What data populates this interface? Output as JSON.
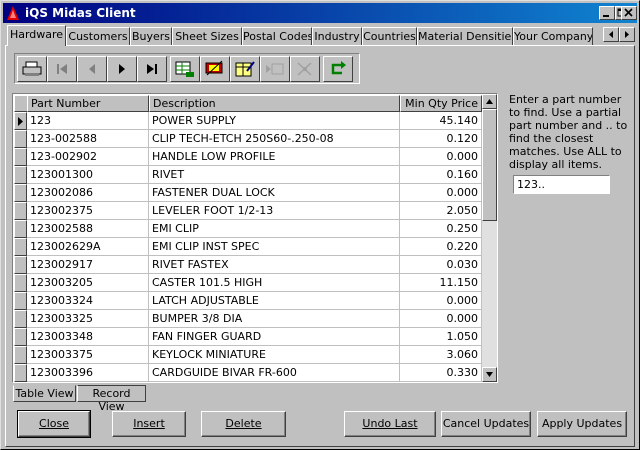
{
  "window": {
    "title": "iQS Midas Client"
  },
  "tabs": [
    "Hardware",
    "Customers",
    "Buyers",
    "Sheet Sizes",
    "Postal Codes",
    "Industry",
    "Countries",
    "Material Densities",
    "Your Company"
  ],
  "toolbar": {
    "icons": [
      "print-icon",
      "first-record-icon",
      "previous-record-icon",
      "next-record-icon",
      "last-record-icon",
      "table-edit-icon",
      "cut-records-icon",
      "edit-form-icon",
      "insert-disabled-icon",
      "delete-disabled-icon",
      "refresh-icon"
    ]
  },
  "grid": {
    "columns": [
      "Part Number",
      "Description",
      "Min Qty Price"
    ],
    "rows": [
      {
        "pn": "123",
        "desc": "POWER SUPPLY",
        "price": "45.140"
      },
      {
        "pn": "123-002588",
        "desc": "CLIP TECH-ETCH 250S60-.250-08",
        "price": "0.120"
      },
      {
        "pn": "123-002902",
        "desc": "HANDLE LOW PROFILE",
        "price": "0.000"
      },
      {
        "pn": "123001300",
        "desc": "RIVET",
        "price": "0.160"
      },
      {
        "pn": "123002086",
        "desc": "FASTENER DUAL LOCK",
        "price": "0.000"
      },
      {
        "pn": "123002375",
        "desc": "LEVELER FOOT  1/2-13",
        "price": "2.050"
      },
      {
        "pn": "123002588",
        "desc": "EMI CLIP",
        "price": "0.250"
      },
      {
        "pn": "123002629A",
        "desc": "EMI CLIP  INST SPEC",
        "price": "0.220"
      },
      {
        "pn": "123002917",
        "desc": "RIVET FASTEX",
        "price": "0.030"
      },
      {
        "pn": "123003205",
        "desc": "CASTER  101.5 HIGH",
        "price": "11.150"
      },
      {
        "pn": "123003324",
        "desc": "LATCH ADJUSTABLE",
        "price": "0.000"
      },
      {
        "pn": "123003325",
        "desc": "BUMPER  3/8 DIA",
        "price": "0.000"
      },
      {
        "pn": "123003348",
        "desc": "FAN FINGER GUARD",
        "price": "1.050"
      },
      {
        "pn": "123003375",
        "desc": "KEYLOCK MINIATURE",
        "price": "3.060"
      },
      {
        "pn": "123003396",
        "desc": "CARDGUIDE  BIVAR  FR-600",
        "price": "0.330"
      }
    ]
  },
  "help": {
    "text": "Enter a part number to find.  Use a partial part number and .. to find the closest matches.  Use ALL to display all items."
  },
  "search": {
    "value": "123.."
  },
  "view_tabs": [
    "Table View",
    "Record View"
  ],
  "buttons": {
    "close": "Close",
    "insert": "Insert",
    "delete": "Delete",
    "undo": "Undo Last",
    "cancel": "Cancel Updates",
    "apply": "Apply Updates"
  }
}
